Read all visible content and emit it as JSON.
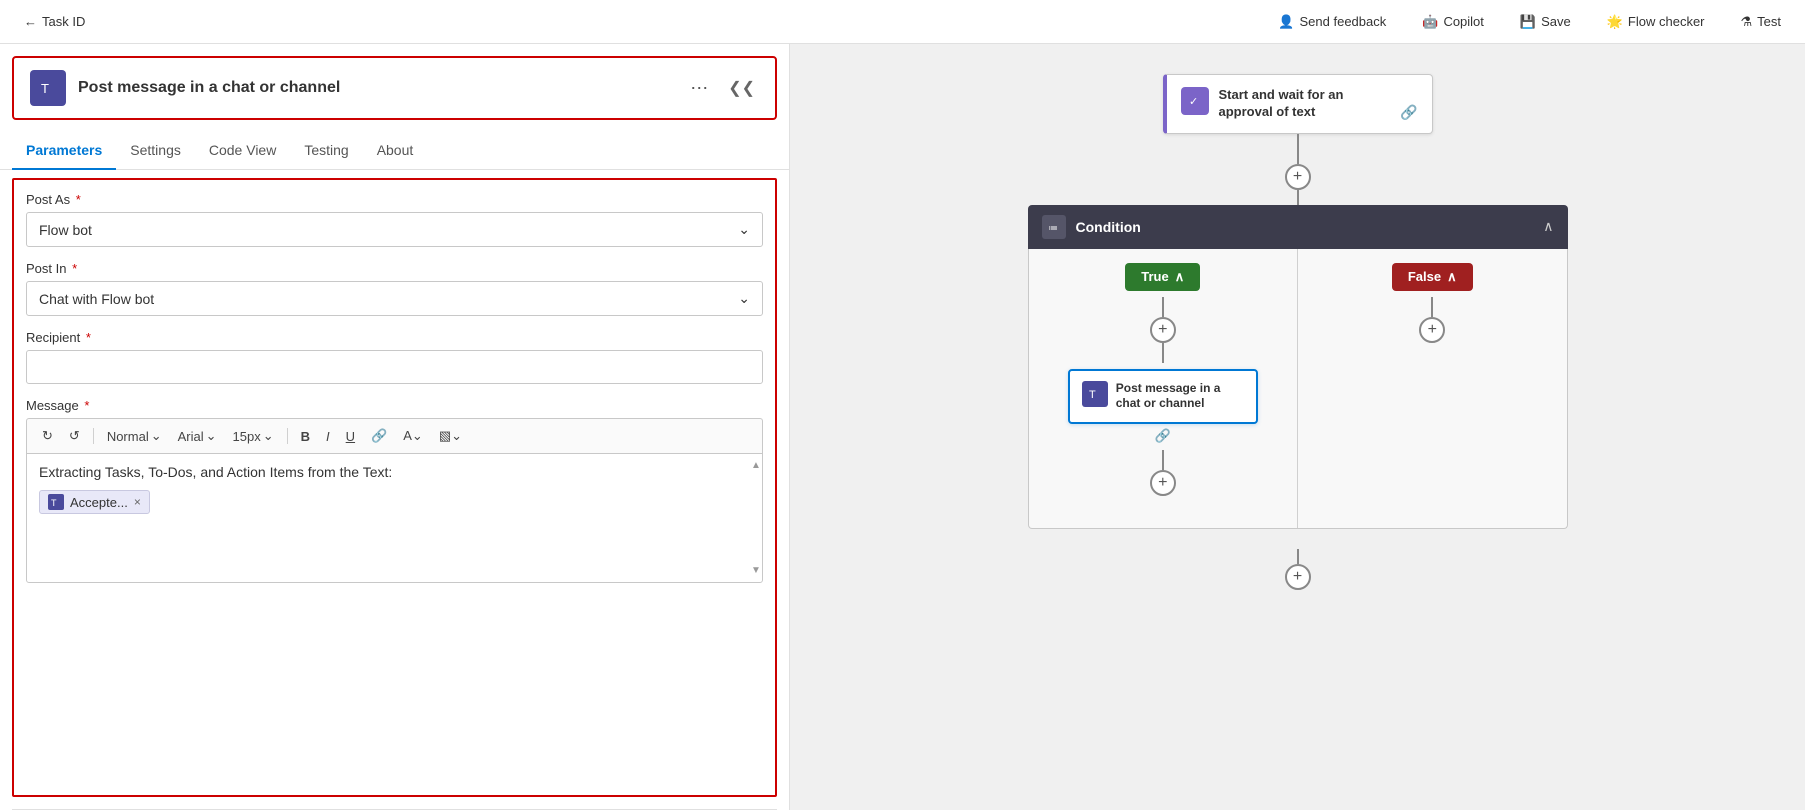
{
  "topbar": {
    "back_label": "Task ID",
    "send_feedback_label": "Send feedback",
    "copilot_label": "Copilot",
    "save_label": "Save",
    "flow_checker_label": "Flow checker",
    "test_label": "Test"
  },
  "action_panel": {
    "title": "Post message in a chat or channel",
    "tabs": [
      "Parameters",
      "Settings",
      "Code View",
      "Testing",
      "About"
    ],
    "active_tab": "Parameters",
    "fields": {
      "post_as_label": "Post As",
      "post_as_value": "Flow bot",
      "post_in_label": "Post In",
      "post_in_value": "Chat with Flow bot",
      "recipient_label": "Recipient",
      "recipient_value": "",
      "message_label": "Message"
    },
    "rte": {
      "style_label": "Normal",
      "font_label": "Arial",
      "size_label": "15px",
      "message_text": "Extracting Tasks, To-Dos, and Action Items from the Text:",
      "tag_label": "Accepte...",
      "undo_label": "↺",
      "redo_label": "↻"
    }
  },
  "flow": {
    "approval_card_title": "Start and wait for an approval of text",
    "condition_title": "Condition",
    "true_label": "True",
    "false_label": "False",
    "post_card_title": "Post message in a chat or channel"
  }
}
